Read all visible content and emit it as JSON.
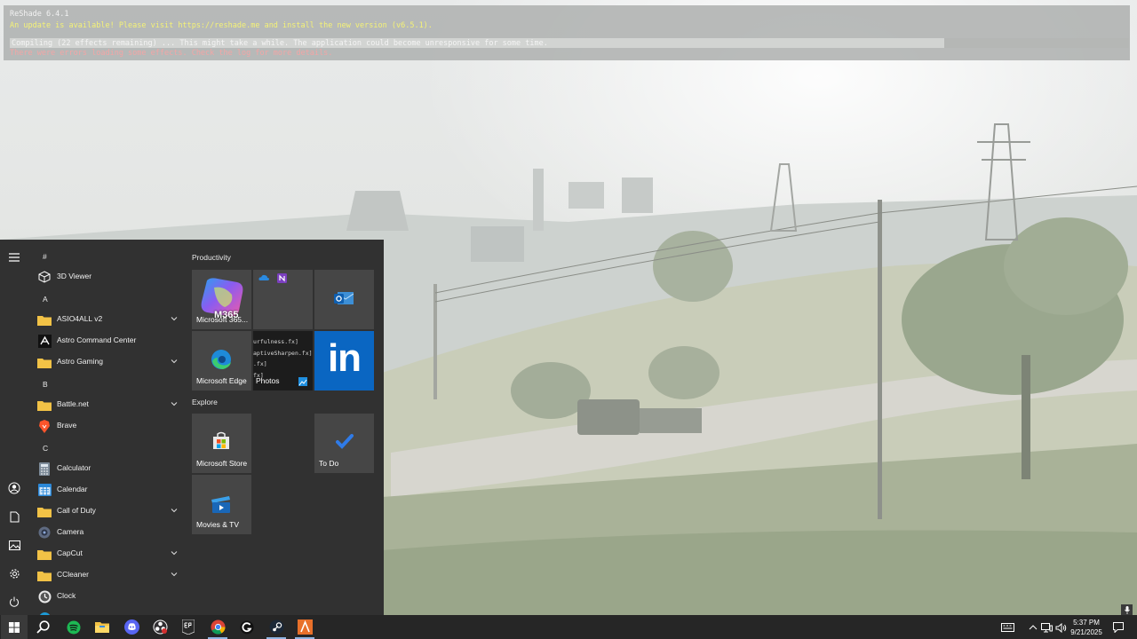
{
  "reshade": {
    "title": "ReShade 6.4.1",
    "update_notice": "An update is available! Please visit https://reshade.me and install the new version (v6.5.1).",
    "compiling_text": "Compiling (22 effects remaining) ... This might take a while. The application could become unresponsive for some time.",
    "error_text": "There were errors loading some effects. Check the log for more details.",
    "progress_fraction": 0.835
  },
  "start_menu": {
    "rail": {
      "menu_icon": "hamburger-icon",
      "user_icon": "user-icon",
      "documents_icon": "document-icon",
      "pictures_icon": "pictures-icon",
      "settings_icon": "gear-icon",
      "power_icon": "power-icon"
    },
    "letters": [
      "#",
      "A",
      "B",
      "C"
    ],
    "apps": [
      {
        "label": "3D Viewer",
        "icon": "cube-icon"
      },
      {
        "label": "ASIO4ALL v2",
        "icon": "folder-icon",
        "expandable": true
      },
      {
        "label": "Astro Command Center",
        "icon": "astro-icon"
      },
      {
        "label": "Astro Gaming",
        "icon": "folder-icon",
        "expandable": true
      },
      {
        "label": "Battle.net",
        "icon": "folder-icon",
        "expandable": true
      },
      {
        "label": "Brave",
        "icon": "brave-icon"
      },
      {
        "label": "Calculator",
        "icon": "calculator-icon"
      },
      {
        "label": "Calendar",
        "icon": "calendar-icon"
      },
      {
        "label": "Call of Duty",
        "icon": "folder-icon",
        "expandable": true
      },
      {
        "label": "Camera",
        "icon": "camera-icon"
      },
      {
        "label": "CapCut",
        "icon": "folder-icon",
        "expandable": true
      },
      {
        "label": "CCleaner",
        "icon": "folder-icon",
        "expandable": true
      },
      {
        "label": "Clock",
        "icon": "clock-icon"
      }
    ],
    "groups": {
      "productivity": "Productivity",
      "explore": "Explore"
    },
    "tiles": {
      "m365_badge": "M365",
      "m365_label": "Microsoft 365...",
      "edge_label": "Microsoft Edge",
      "photos_label": "Photos",
      "photos_lines": [
        "urfulness.fx]",
        "aptiveSharpen.fx]",
        ".fx]",
        "fx]"
      ],
      "store_label": "Microsoft Store",
      "todo_label": "To Do",
      "movies_label": "Movies & TV",
      "linkedin_text": "in"
    }
  },
  "taskbar": {
    "apps": [
      "start-icon",
      "search-icon",
      "spotify-icon",
      "file-explorer-icon",
      "discord-icon",
      "obs-icon",
      "epic-games-icon",
      "chrome-icon",
      "g-hub-icon",
      "steam-icon",
      "game-launcher-icon"
    ],
    "time": "5:37 PM",
    "date": "9/21/2025"
  },
  "colors": {
    "accent": "#0078d4",
    "folder": "#f2c246",
    "linkedin": "#0a66c2"
  }
}
